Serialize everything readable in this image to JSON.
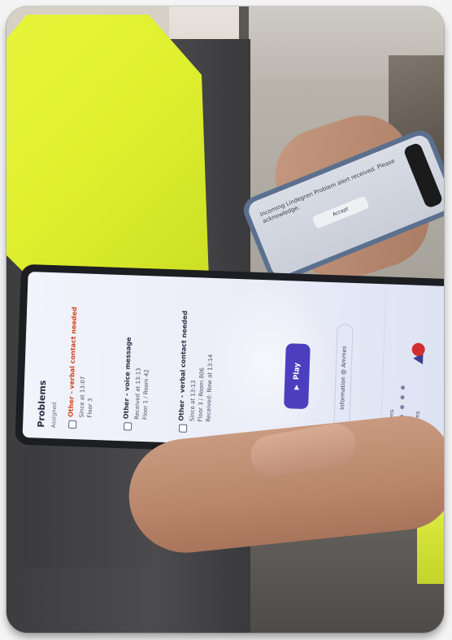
{
  "phone": {
    "notification_text": "Incoming Lindegren Problem alert received. Please acknowledge.",
    "button_label": "Accept"
  },
  "tablet": {
    "app_title": "Problems",
    "app_subtitle": "Assigned",
    "problems": [
      {
        "title": "Other - verbal contact needed",
        "lines": [
          "Since at 13:07",
          "Floor 3"
        ]
      },
      {
        "title": "Other - voice message",
        "lines": [
          "Received at 13:13",
          "Floor 1 / Room 42"
        ]
      },
      {
        "title": "Other - verbal contact needed",
        "lines": [
          "Since at 13:13",
          "Floor 3 / Room 806",
          "Received: Now at 13:14"
        ]
      }
    ],
    "play_label": "Play",
    "assigned_to": "Information @ Ammes",
    "sidebar": {
      "locations_label": "Locations",
      "problems_label": "Problems"
    },
    "colors": {
      "accent": "#4b3fbf",
      "alert_title": "#d0471e"
    }
  }
}
